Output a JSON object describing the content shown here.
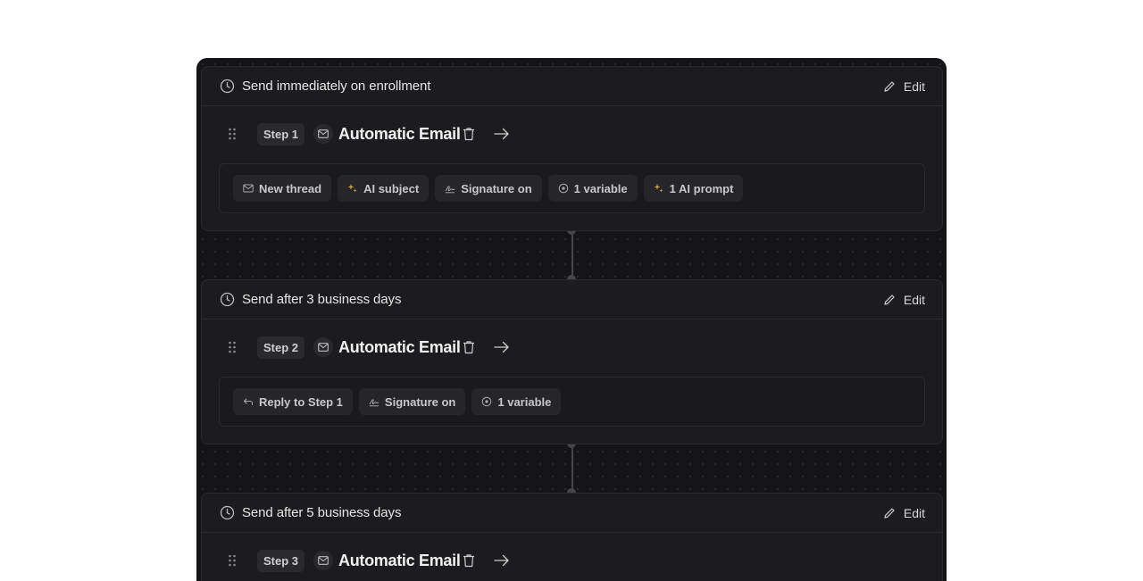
{
  "steps": [
    {
      "timing": "Send immediately on enrollment",
      "edit_label": "Edit",
      "step_label": "Step 1",
      "title": "Automatic Email",
      "chips": [
        {
          "icon": "envelope-icon",
          "label": "New thread"
        },
        {
          "icon": "sparkle-icon",
          "label": "AI subject"
        },
        {
          "icon": "signature-icon",
          "label": "Signature on"
        },
        {
          "icon": "variable-icon",
          "label": "1 variable"
        },
        {
          "icon": "sparkle-icon",
          "label": "1 AI prompt"
        }
      ]
    },
    {
      "timing": "Send after 3 business days",
      "edit_label": "Edit",
      "step_label": "Step 2",
      "title": "Automatic Email",
      "chips": [
        {
          "icon": "reply-icon",
          "label": "Reply to Step 1"
        },
        {
          "icon": "signature-icon",
          "label": "Signature on"
        },
        {
          "icon": "variable-icon",
          "label": "1 variable"
        }
      ]
    },
    {
      "timing": "Send after 5 business days",
      "edit_label": "Edit",
      "step_label": "Step 3",
      "title": "Automatic Email",
      "chips": []
    }
  ],
  "colors": {
    "canvas": "#151517",
    "card": "#1c1c1f",
    "sparkle": "#e0a030"
  }
}
